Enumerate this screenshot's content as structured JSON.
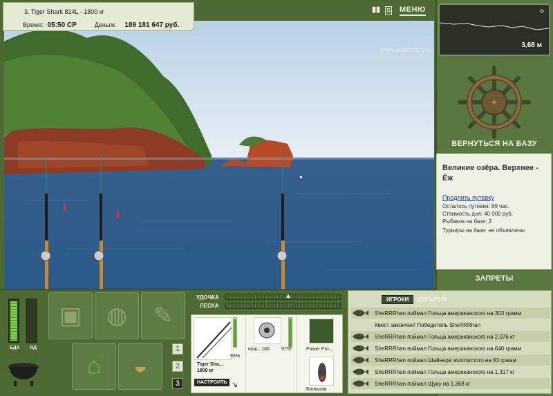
{
  "header": {
    "target_line": "3. Tiger Shark 814L - 1800 кг",
    "time_label": "Время:",
    "time_value": "05:50 СР",
    "money_label": "Деньги:",
    "money_value": "189 181 647 руб.",
    "pause_icon": "pause-icon",
    "settings_icon": "settings-icon",
    "menu_label": "МЕНЮ"
  },
  "watermark": "WWW.WAIRTOBET.RU",
  "depth": {
    "value": "3,68 м"
  },
  "base": {
    "return_label": "ВЕРНУТЬСЯ НА БАЗУ",
    "location_title": "Великие озёра. Верхнее - Ёж",
    "extend_link": "Продлить путевку",
    "lines": [
      "Осталось путевки: 89 час.",
      "Стоимость дня: 40 000 руб.",
      "Рыбаков на базе: 2",
      "Турниры на базе: не объявлены"
    ],
    "bans_label": "ЗАПРЕТЫ"
  },
  "meters": {
    "food_label": "ЕДА",
    "poison_label": "ЯД",
    "food_level": 0.92,
    "poison_level": 0.0
  },
  "inventory": {
    "tabs": [
      "1",
      "2",
      "3"
    ],
    "active_tab": "3"
  },
  "gear": {
    "rod_label": "УДОЧКА",
    "line_label": "ЛЕСКА",
    "rod_name": "Tiger Sha...",
    "rod_weight": "1800 кг",
    "rod_percent": "95%",
    "reel_caption": "нош.: 180",
    "reel_percent": "97%",
    "line_caption": "Power Pro...",
    "lure_caption": "Большая",
    "setup_label": "НАСТРОИТЬ"
  },
  "events": {
    "tab_players": "ИГРОКИ",
    "tab_events": "СОБЫТИЯ",
    "rows": [
      {
        "text": "SheRRRhan поймал Гольца американского на 303 грамм",
        "fish": true
      },
      {
        "text": "Квест закончен! Победитель SheRRRhan",
        "fish": false
      },
      {
        "text": "SheRRRhan поймал Гольца американского на 2,076 кг",
        "fish": true
      },
      {
        "text": "SheRRRhan поймал Гольца американского на 640 грамм",
        "fish": true
      },
      {
        "text": "SheRRRhan поймал Шайнера золотистого на 83 грамм",
        "fish": true
      },
      {
        "text": "SheRRRhan поймал Гольца американского на 1,317 кг",
        "fish": true
      },
      {
        "text": "SheRRRhan поймал Щуку на 1,368 кг",
        "fish": true
      }
    ]
  }
}
